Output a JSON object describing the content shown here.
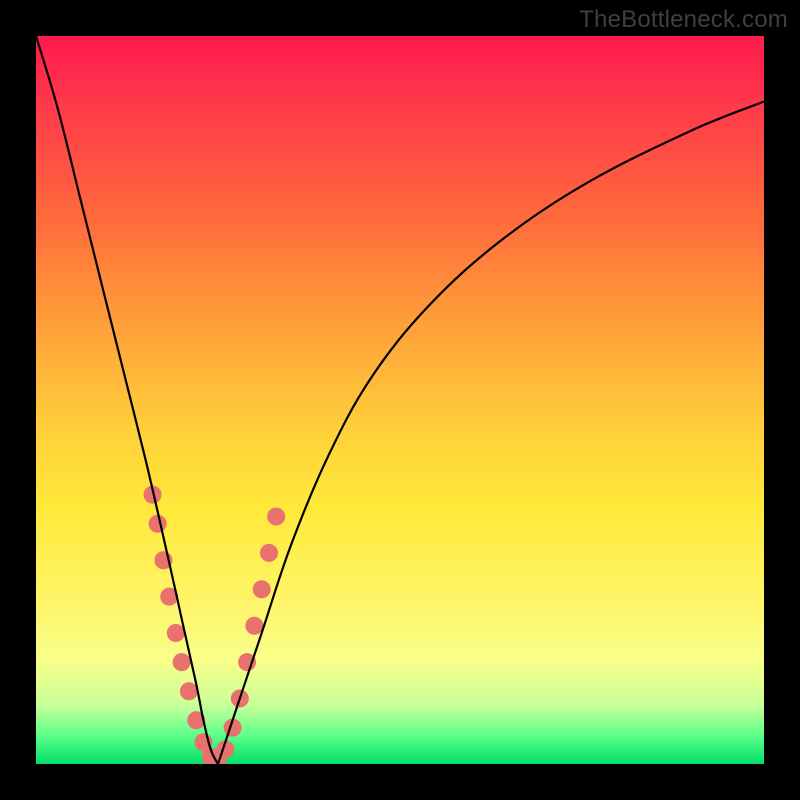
{
  "watermark": "TheBottleneck.com",
  "colors": {
    "frame": "#000000",
    "curve": "#000000",
    "bead": "#e9716e",
    "gradient_stops": [
      "#ff1a4d",
      "#ff6a3c",
      "#ffd23a",
      "#f7ff8a",
      "#00e06a"
    ]
  },
  "chart_data": {
    "type": "line",
    "title": "",
    "xlabel": "",
    "ylabel": "",
    "xlim": [
      0,
      100
    ],
    "ylim": [
      0,
      100
    ],
    "annotations": [
      "TheBottleneck.com"
    ],
    "legend": false,
    "grid": false,
    "description": "Two steep V-shaped curves meeting near x≈24 at y≈0 over a vertical red-to-green gradient background; a cluster of salmon beads sits along the lower portion of both branches near the vertex.",
    "series": [
      {
        "name": "left-branch",
        "x": [
          0,
          3,
          6,
          9,
          12,
          15,
          18,
          20,
          22,
          23,
          24,
          25
        ],
        "values": [
          100,
          90,
          78,
          66,
          54,
          42,
          29,
          20,
          11,
          6,
          2,
          0
        ]
      },
      {
        "name": "right-branch",
        "x": [
          25,
          26,
          28,
          31,
          35,
          40,
          46,
          54,
          64,
          76,
          90,
          100
        ],
        "values": [
          0,
          3,
          9,
          18,
          30,
          42,
          53,
          63,
          72,
          80,
          87,
          91
        ]
      }
    ],
    "beads": {
      "name": "highlighted-points",
      "points": [
        {
          "x": 16.0,
          "y": 37
        },
        {
          "x": 16.7,
          "y": 33
        },
        {
          "x": 17.5,
          "y": 28
        },
        {
          "x": 18.3,
          "y": 23
        },
        {
          "x": 19.2,
          "y": 18
        },
        {
          "x": 20.0,
          "y": 14
        },
        {
          "x": 21.0,
          "y": 10
        },
        {
          "x": 22.0,
          "y": 6
        },
        {
          "x": 23.0,
          "y": 3
        },
        {
          "x": 24.0,
          "y": 1
        },
        {
          "x": 25.0,
          "y": 0
        },
        {
          "x": 26.0,
          "y": 2
        },
        {
          "x": 27.0,
          "y": 5
        },
        {
          "x": 28.0,
          "y": 9
        },
        {
          "x": 29.0,
          "y": 14
        },
        {
          "x": 30.0,
          "y": 19
        },
        {
          "x": 31.0,
          "y": 24
        },
        {
          "x": 32.0,
          "y": 29
        },
        {
          "x": 33.0,
          "y": 34
        }
      ]
    }
  }
}
